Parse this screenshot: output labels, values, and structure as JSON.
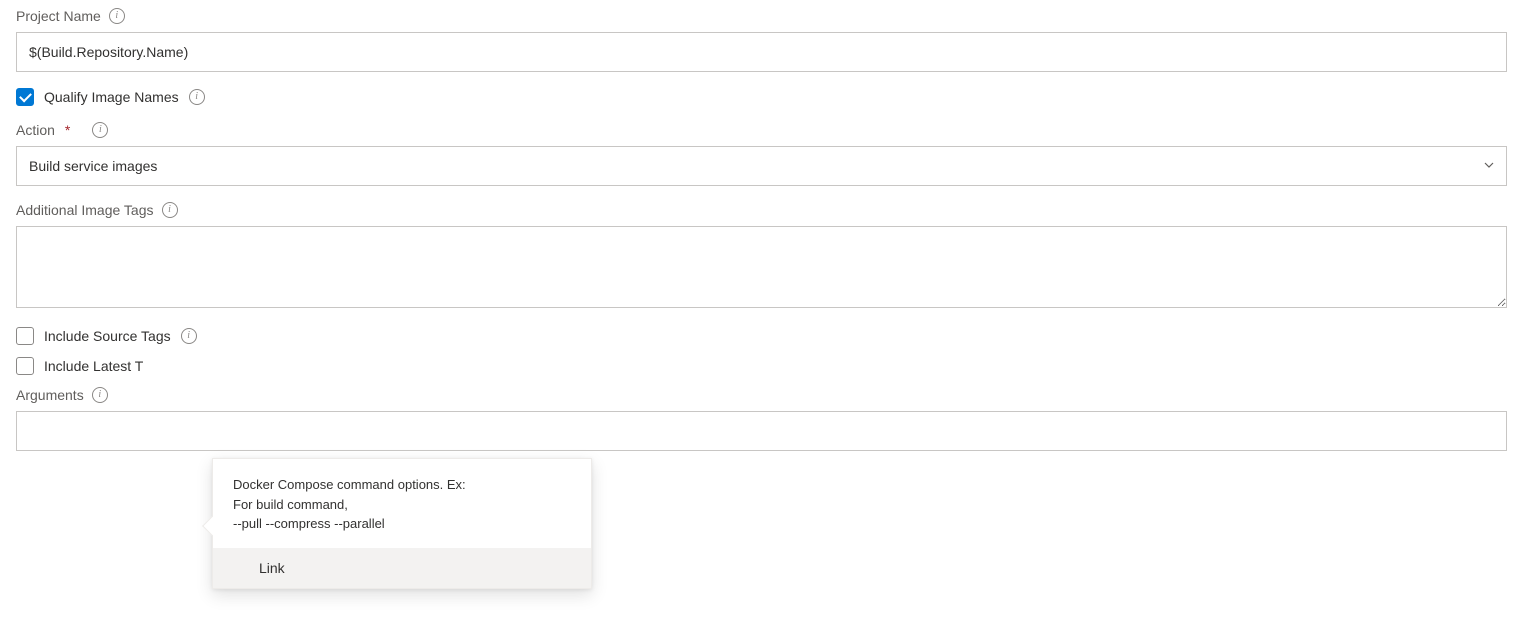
{
  "project_name": {
    "label": "Project Name",
    "value": "$(Build.Repository.Name)"
  },
  "qualify_image_names": {
    "label": "Qualify Image Names",
    "checked": true
  },
  "action": {
    "label": "Action",
    "required": "*",
    "value": "Build service images"
  },
  "additional_image_tags": {
    "label": "Additional Image Tags",
    "value": ""
  },
  "include_source_tags": {
    "label": "Include Source Tags",
    "checked": false
  },
  "include_latest_tag": {
    "label": "Include Latest T",
    "checked": false
  },
  "arguments": {
    "label": "Arguments",
    "value": ""
  },
  "tooltip": {
    "line1": "Docker Compose command options. Ex:",
    "line2": "For build command,",
    "line3": "--pull --compress --parallel",
    "link": "Link"
  },
  "icons": {
    "info": "i"
  }
}
